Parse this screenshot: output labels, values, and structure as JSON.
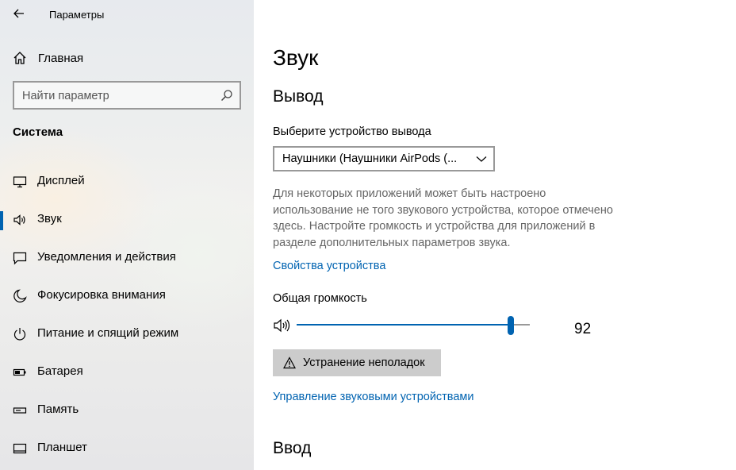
{
  "window": {
    "title": "Параметры"
  },
  "sidebar": {
    "home_label": "Главная",
    "search_placeholder": "Найти параметр",
    "section_title": "Система",
    "items": [
      {
        "label": "Дисплей",
        "icon": "monitor-icon",
        "selected": false
      },
      {
        "label": "Звук",
        "icon": "speaker-icon",
        "selected": true
      },
      {
        "label": "Уведомления и действия",
        "icon": "notification-icon",
        "selected": false
      },
      {
        "label": "Фокусировка внимания",
        "icon": "moon-icon",
        "selected": false
      },
      {
        "label": "Питание и спящий режим",
        "icon": "power-icon",
        "selected": false
      },
      {
        "label": "Батарея",
        "icon": "battery-icon",
        "selected": false
      },
      {
        "label": "Память",
        "icon": "storage-icon",
        "selected": false
      },
      {
        "label": "Планшет",
        "icon": "tablet-icon",
        "selected": false
      }
    ]
  },
  "main": {
    "title": "Звук",
    "output": {
      "heading": "Вывод",
      "device_label": "Выберите устройство вывода",
      "device_value": "Наушники (Наушники AirPods (...",
      "description": "Для некоторых приложений может быть настроено использование не того звукового устройства, которое отмечено здесь. Настройте громкость и устройства для приложений в разделе дополнительных параметров звука.",
      "device_properties_link": "Свойства устройства",
      "volume_label": "Общая громкость",
      "volume_value": "92",
      "volume_level": 92,
      "troubleshoot_label": "Устранение неполадок",
      "manage_devices_link": "Управление звуковыми устройствами"
    },
    "input": {
      "heading": "Ввод"
    }
  },
  "colors": {
    "accent": "#0063b1",
    "sidebar_bg": "#eceeee",
    "button_bg": "#cccccc"
  }
}
